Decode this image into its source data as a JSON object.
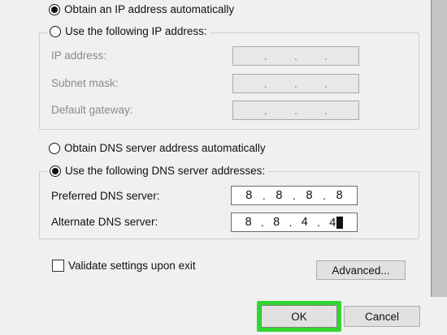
{
  "ip_section": {
    "auto_label": "Obtain an IP address automatically",
    "manual_label": "Use the following IP address:",
    "fields": [
      {
        "label": "IP address:",
        "octets": [
          "",
          "",
          "",
          ""
        ]
      },
      {
        "label": "Subnet mask:",
        "octets": [
          "",
          "",
          "",
          ""
        ]
      },
      {
        "label": "Default gateway:",
        "octets": [
          "",
          "",
          "",
          ""
        ]
      }
    ]
  },
  "dns_section": {
    "auto_label": "Obtain DNS server address automatically",
    "manual_label": "Use the following DNS server addresses:",
    "preferred_label": "Preferred DNS server:",
    "preferred_octets": [
      "8",
      "8",
      "8",
      "8"
    ],
    "alternate_label": "Alternate DNS server:",
    "alternate_octets": [
      "8",
      "8",
      "4",
      "4"
    ]
  },
  "validate_label": "Validate settings upon exit",
  "buttons": {
    "advanced": "Advanced...",
    "ok": "OK",
    "cancel": "Cancel"
  },
  "colors": {
    "highlight": "#30d62f"
  }
}
